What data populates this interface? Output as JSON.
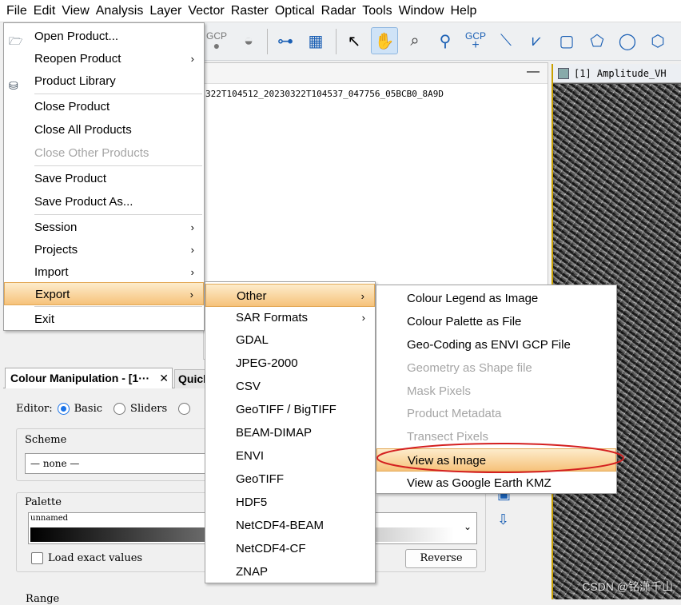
{
  "menubar": [
    "File",
    "Edit",
    "View",
    "Analysis",
    "Layer",
    "Vector",
    "Raster",
    "Optical",
    "Radar",
    "Tools",
    "Window",
    "Help"
  ],
  "toolbar": {
    "gcp_label_1": "GCP",
    "gcp_label_2": "GCP"
  },
  "product_panel": {
    "product_name_fragment": "322T104512_20230322T104537_047756_05BCB0_8A9D",
    "minimize": "—"
  },
  "image_view": {
    "title": "[1] Amplitude_VH"
  },
  "file_menu": {
    "items": [
      {
        "label": "Open Product..."
      },
      {
        "label": "Reopen Product",
        "submenu": true
      },
      {
        "label": "Product Library"
      },
      {
        "label": "Close Product"
      },
      {
        "label": "Close All Products"
      },
      {
        "label": "Close Other Products",
        "disabled": true
      },
      {
        "label": "Save Product"
      },
      {
        "label": "Save Product As..."
      },
      {
        "label": "Session",
        "submenu": true
      },
      {
        "label": "Projects",
        "submenu": true
      },
      {
        "label": "Import",
        "submenu": true
      },
      {
        "label": "Export",
        "submenu": true,
        "highlighted": true
      },
      {
        "label": "Exit"
      }
    ]
  },
  "export_menu": {
    "items": [
      {
        "label": "Other",
        "submenu": true,
        "highlighted": true
      },
      {
        "label": "SAR Formats",
        "submenu": true
      },
      {
        "label": "GDAL"
      },
      {
        "label": "JPEG-2000"
      },
      {
        "label": "CSV"
      },
      {
        "label": "GeoTIFF / BigTIFF"
      },
      {
        "label": "BEAM-DIMAP"
      },
      {
        "label": "ENVI"
      },
      {
        "label": "GeoTIFF"
      },
      {
        "label": "HDF5"
      },
      {
        "label": "NetCDF4-BEAM"
      },
      {
        "label": "NetCDF4-CF"
      },
      {
        "label": "ZNAP"
      }
    ]
  },
  "other_menu": {
    "items": [
      {
        "label": "Colour Legend as Image"
      },
      {
        "label": "Colour Palette as File"
      },
      {
        "label": "Geo-Coding as ENVI GCP File"
      },
      {
        "label": "Geometry as Shape file",
        "disabled": true
      },
      {
        "label": "Mask Pixels",
        "disabled": true
      },
      {
        "label": "Product Metadata",
        "disabled": true
      },
      {
        "label": "Transect Pixels",
        "disabled": true
      },
      {
        "label": "View as Image",
        "highlighted": true,
        "circled": true
      },
      {
        "label": "View as Google Earth KMZ"
      }
    ]
  },
  "colour_panel": {
    "tab1": "Colour Manipulation - [1···",
    "tab1_close": "✕",
    "tab2": "Quick",
    "editor_label": "Editor:",
    "basic": "Basic",
    "sliders": "Sliders",
    "scheme_label": "Scheme",
    "scheme_value": "— none —",
    "palette_label": "Palette",
    "palette_name": "unnamed",
    "load_exact": "Load exact values",
    "reverse": "Reverse",
    "range_label": "Range"
  },
  "watermark": "CSDN @铭潇千山",
  "colors": {
    "highlight_top": "#fdeccb",
    "highlight_bottom": "#f6c27a",
    "circle": "#d42020"
  }
}
